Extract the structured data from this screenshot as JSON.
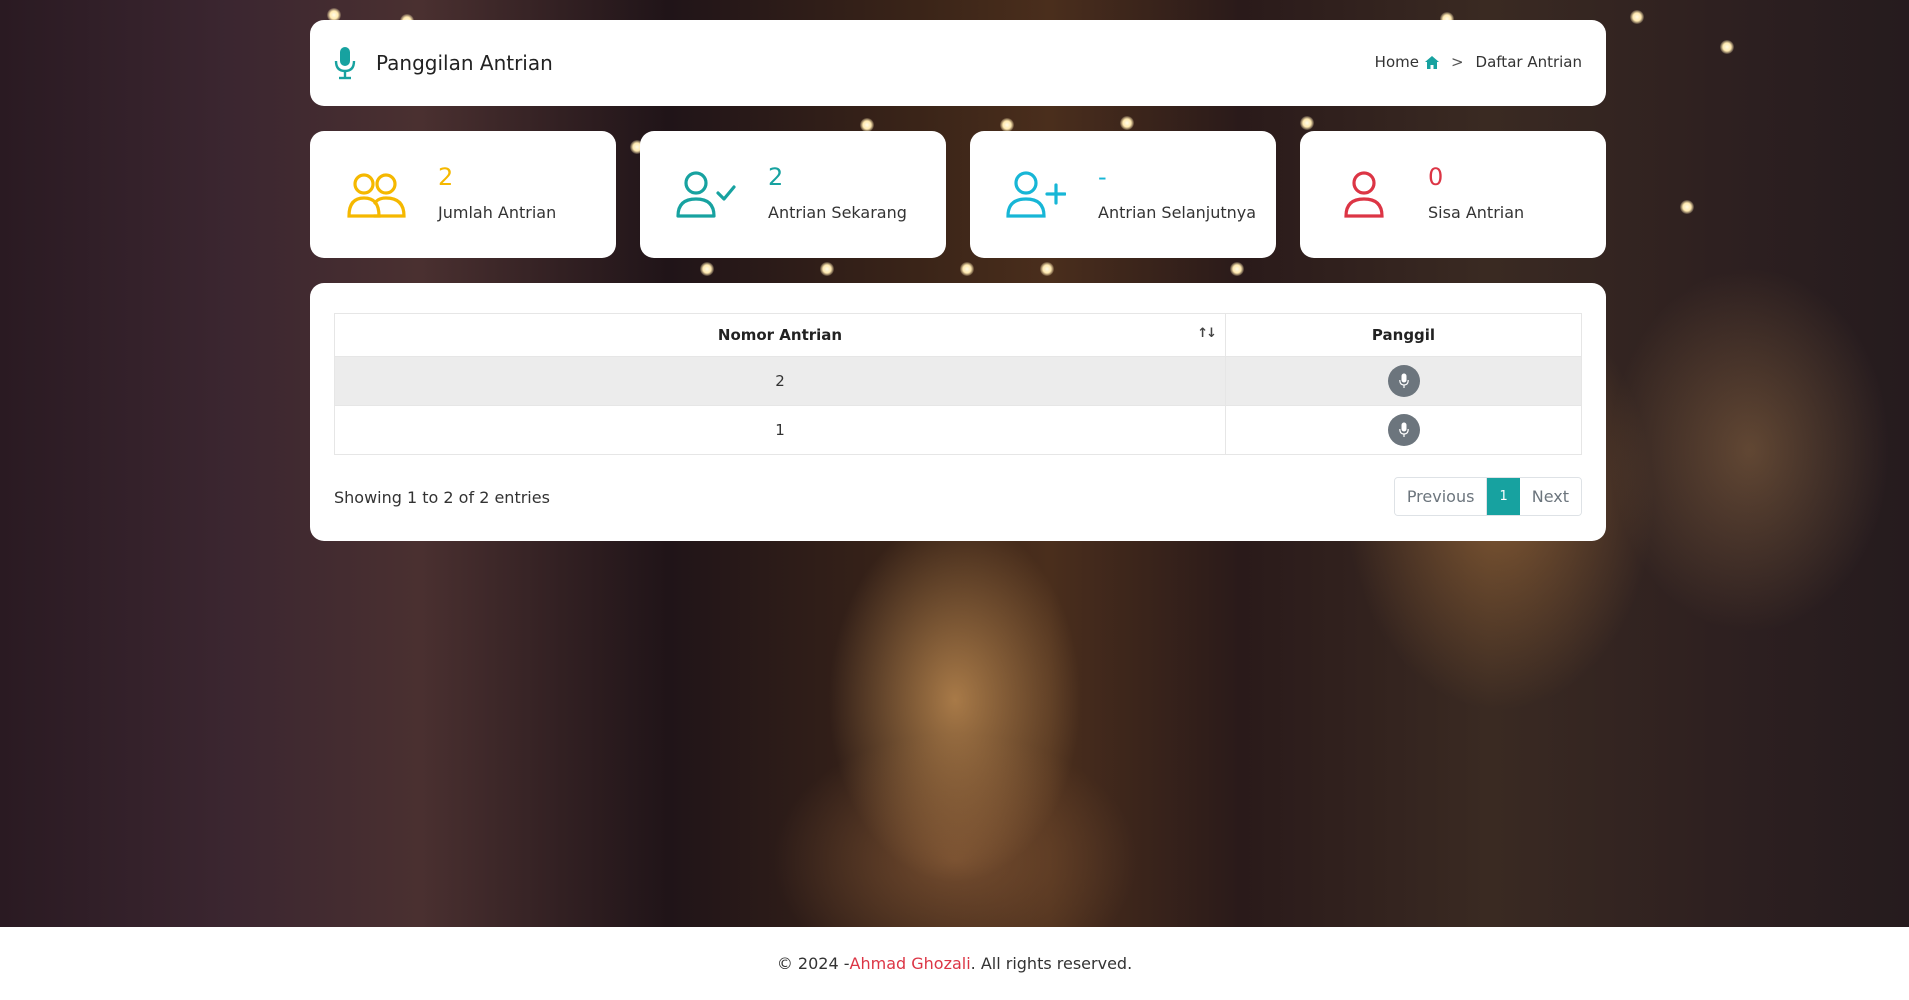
{
  "header": {
    "title": "Panggilan Antrian",
    "breadcrumb": {
      "home": "Home",
      "separator": ">",
      "current": "Daftar Antrian"
    },
    "icons": {
      "title": "microphone-icon",
      "home": "home-icon"
    }
  },
  "stats": [
    {
      "value": "2",
      "label": "Jumlah Antrian",
      "icon": "users-icon",
      "color": "#f5b800"
    },
    {
      "value": "2",
      "label": "Antrian Sekarang",
      "icon": "user-check-icon",
      "color": "#17a2a0"
    },
    {
      "value": "-",
      "label": "Antrian Selanjutnya",
      "icon": "user-plus-icon",
      "color": "#17b6d6"
    },
    {
      "value": "0",
      "label": "Sisa Antrian",
      "icon": "user-icon",
      "color": "#dc3545"
    }
  ],
  "table": {
    "columns": [
      "Nomor Antrian",
      "Panggil"
    ],
    "rows": [
      {
        "nomor": "2",
        "action_icon": "microphone-icon"
      },
      {
        "nomor": "1",
        "action_icon": "microphone-icon"
      }
    ],
    "info": "Showing 1 to 2 of 2 entries",
    "pagination": {
      "previous": "Previous",
      "current_page": "1",
      "next": "Next"
    }
  },
  "footer": {
    "prefix": "© 2024 - ",
    "author": "Ahmad Ghozali",
    "suffix": ". All rights reserved."
  },
  "colors": {
    "accent": "#17a2a0",
    "button_gray": "#6c757d",
    "author_link": "#dc3545"
  }
}
